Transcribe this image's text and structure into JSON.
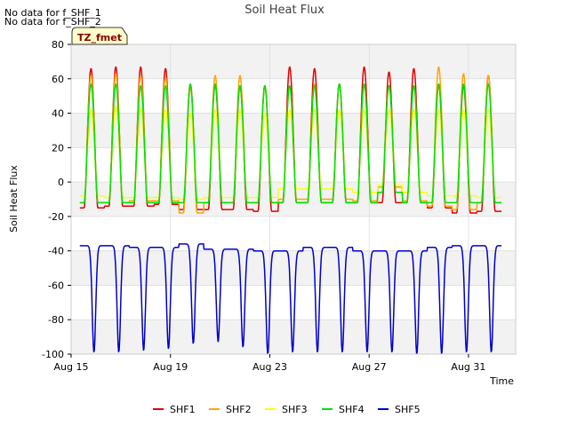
{
  "notes": [
    "No data for f_SHF_1",
    "No data for f_SHF_2"
  ],
  "site_label": "TZ_fmet",
  "chart_data": {
    "type": "line",
    "title": "Soil Heat Flux",
    "xlabel": "Time",
    "ylabel": "Soil Heat Flux",
    "x_start": "2016-08-15",
    "x_end": "2016-09-02",
    "xlim_days": [
      0,
      17.9
    ],
    "ylim": [
      -100,
      80
    ],
    "yticks": [
      -100,
      -80,
      -60,
      -40,
      -20,
      0,
      20,
      40,
      60,
      80
    ],
    "xticks": [
      {
        "day": 0,
        "label": "Aug 15"
      },
      {
        "day": 4,
        "label": "Aug 19"
      },
      {
        "day": 8,
        "label": "Aug 23"
      },
      {
        "day": 12,
        "label": "Aug 27"
      },
      {
        "day": 16,
        "label": "Aug 31"
      }
    ],
    "grid": true,
    "legend_position": "bottom",
    "series": [
      {
        "name": "SHF1",
        "color": "#e00000",
        "daily_max": [
          66,
          67,
          67,
          66,
          57,
          57,
          56,
          56,
          67,
          66,
          57,
          67,
          64,
          66,
          57,
          56,
          62
        ],
        "daily_min": [
          -15,
          -14,
          -14,
          -13,
          -16,
          -16,
          -16,
          -17,
          -12,
          -12,
          -12,
          -12,
          -12,
          -12,
          -15,
          -18,
          -17
        ]
      },
      {
        "name": "SHF2",
        "color": "#ffa500",
        "daily_max": [
          62,
          63,
          62,
          61,
          55,
          62,
          62,
          55,
          56,
          57,
          57,
          57,
          56,
          56,
          67,
          63,
          62
        ],
        "daily_min": [
          -12,
          -12,
          -11,
          -11,
          -18,
          -12,
          -12,
          -12,
          -10,
          -10,
          -10,
          -11,
          -3,
          -11,
          -14,
          -16,
          -12
        ]
      },
      {
        "name": "SHF3",
        "color": "#ffff00",
        "daily_max": [
          42,
          44,
          43,
          42,
          40,
          42,
          42,
          40,
          42,
          42,
          42,
          42,
          42,
          42,
          42,
          42,
          42
        ],
        "daily_min": [
          -8,
          -9,
          -9,
          -9,
          -10,
          -9,
          -9,
          -9,
          -4,
          -4,
          -4,
          -6,
          -2,
          -6,
          -8,
          -8,
          -9
        ]
      },
      {
        "name": "SHF4",
        "color": "#00e000",
        "daily_max": [
          57,
          57,
          56,
          56,
          57,
          57,
          56,
          56,
          56,
          56,
          57,
          57,
          56,
          56,
          57,
          57,
          57
        ],
        "daily_min": [
          -12,
          -12,
          -12,
          -12,
          -12,
          -12,
          -12,
          -12,
          -12,
          -12,
          -12,
          -12,
          -6,
          -12,
          -12,
          -12,
          -12
        ]
      },
      {
        "name": "SHF5",
        "color": "#0000cc",
        "daily_max": [
          -37,
          -37,
          -38,
          -38,
          -36,
          -39,
          -39,
          -40,
          -40,
          -38,
          -38,
          -40,
          -40,
          -40,
          -38,
          -37,
          -37
        ],
        "daily_min": [
          -99,
          -99,
          -98,
          -97,
          -94,
          -93,
          -96,
          -100,
          -99,
          -99,
          -99,
          -99,
          -99,
          -100,
          -100,
          -99,
          -99
        ]
      }
    ]
  }
}
